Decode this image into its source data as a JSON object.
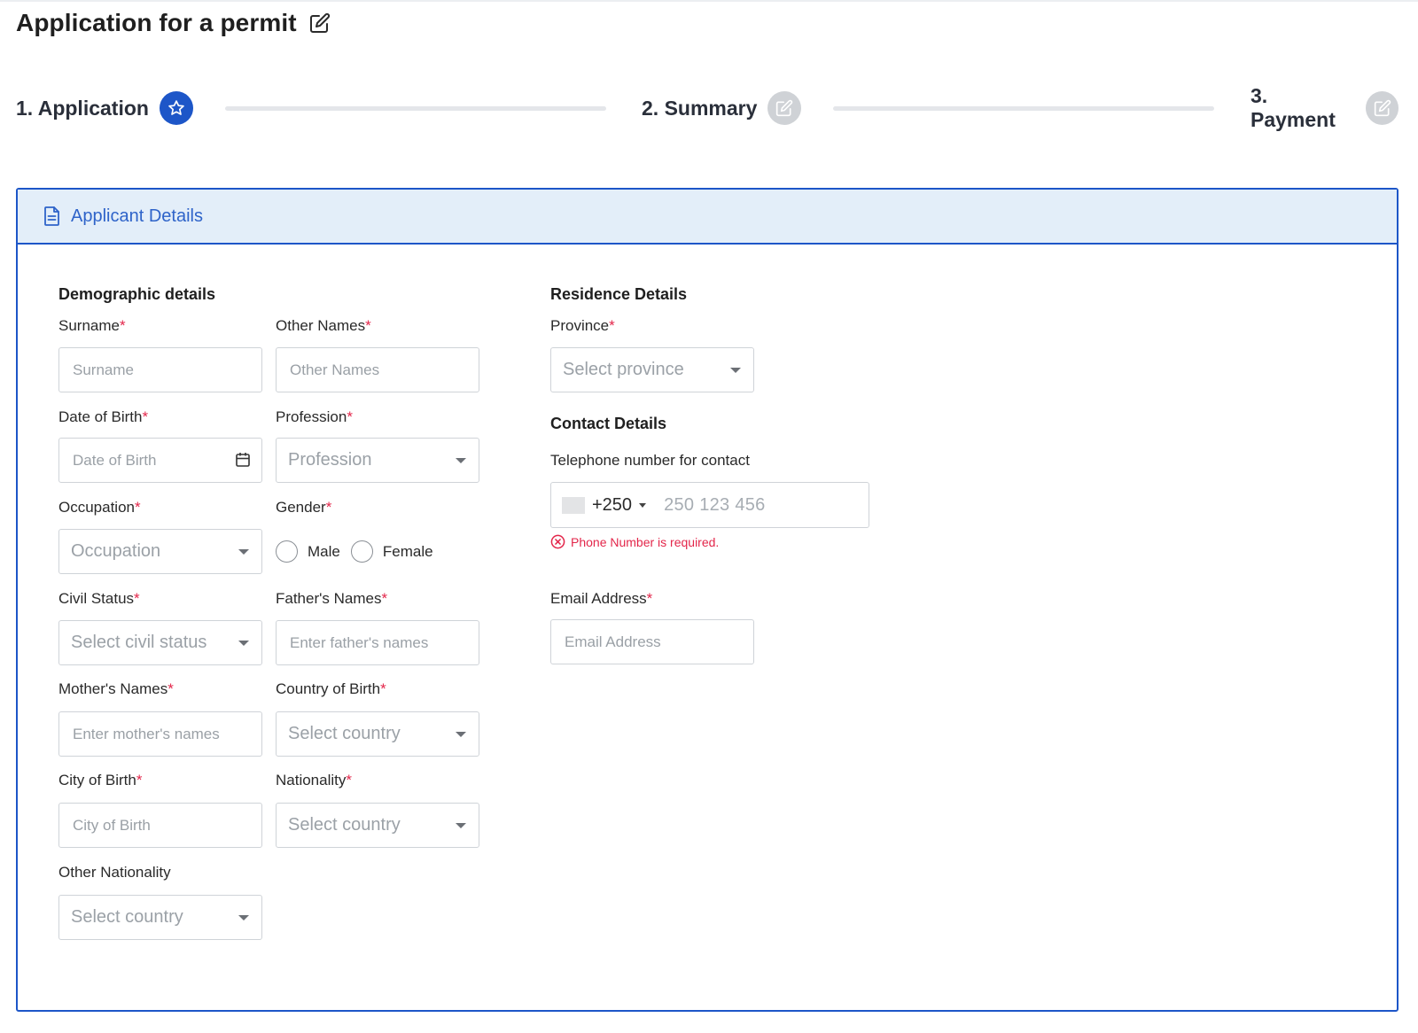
{
  "page": {
    "title": "Application for a permit"
  },
  "stepper": {
    "steps": [
      {
        "label": "1. Application",
        "state": "active",
        "icon": "star-icon"
      },
      {
        "label": "2. Summary",
        "state": "inactive",
        "icon": "edit-icon"
      },
      {
        "label": "3. Payment",
        "state": "inactive",
        "icon": "edit-icon"
      }
    ]
  },
  "card": {
    "header_title": "Applicant Details",
    "header_icon": "document-icon"
  },
  "demographic": {
    "section_title": "Demographic details",
    "surname": {
      "label": "Surname",
      "placeholder": "Surname"
    },
    "other_names": {
      "label": "Other Names",
      "placeholder": "Other Names"
    },
    "dob": {
      "label": "Date of Birth",
      "placeholder": "Date of Birth"
    },
    "profession": {
      "label": "Profession",
      "placeholder": "Profession"
    },
    "occupation": {
      "label": "Occupation",
      "placeholder": "Occupation"
    },
    "gender": {
      "label": "Gender",
      "options": [
        "Male",
        "Female"
      ]
    },
    "civil_status": {
      "label": "Civil Status",
      "placeholder": "Select civil status"
    },
    "fathers_names": {
      "label": "Father's Names",
      "placeholder": "Enter father's names"
    },
    "mothers_names": {
      "label": "Mother's Names",
      "placeholder": "Enter mother's names"
    },
    "country_of_birth": {
      "label": "Country of Birth",
      "placeholder": "Select country"
    },
    "city_of_birth": {
      "label": "City of Birth",
      "placeholder": "City of Birth"
    },
    "nationality": {
      "label": "Nationality",
      "placeholder": "Select country"
    },
    "other_nationality": {
      "label": "Other Nationality",
      "placeholder": "Select country"
    }
  },
  "residence": {
    "section_title": "Residence Details",
    "province": {
      "label": "Province",
      "placeholder": "Select province"
    }
  },
  "contact": {
    "section_title": "Contact Details",
    "phone": {
      "label": "Telephone number for contact",
      "country_code": "+250",
      "placeholder": "250 123 456",
      "error": "Phone Number is required."
    },
    "email": {
      "label": "Email Address",
      "placeholder": "Email Address"
    }
  },
  "required_marker": "*",
  "colors": {
    "primary": "#1d56c8",
    "header_bg": "#e3eef9",
    "error": "#e3264a",
    "inactive_step": "#cfd2d6"
  }
}
